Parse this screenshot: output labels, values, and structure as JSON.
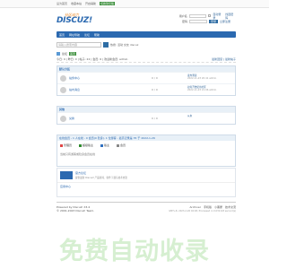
{
  "topbar": {
    "links": [
      "设为首页",
      "收藏本站",
      "开启辅助"
    ],
    "highlight": "切换到窄版"
  },
  "header": {
    "logo_sub": "社区动力",
    "logo_main": "DISCUZ!",
    "login": {
      "user_label": "用户名",
      "pass_label": "密码",
      "auto_login": "自动登录",
      "forgot": "找回密码",
      "login_button": "登录",
      "register": "立即注册"
    }
  },
  "nav": {
    "items": [
      "首页",
      "网址导航",
      "论坛",
      "帮助"
    ]
  },
  "search": {
    "placeholder": "请输入搜索内容",
    "hot": "热搜: 活动 交友 discuz"
  },
  "breadcrumb": {
    "items": [
      "论坛"
    ],
    "current": "首页"
  },
  "stats": {
    "text": "今日: 0 | 昨日: 0 | 帖子: 22 | 会员: 6 | 欢迎新会员: admin",
    "right": "最新回复 | 最新帖子"
  },
  "categories": [
    {
      "name": "默认分区",
      "forums": [
        {
          "name": "站务中心",
          "count": "0 / 0",
          "last_title": "发布测试",
          "last_meta": "2022-11-23 20:41 admin"
        },
        {
          "name": "站内消息",
          "count": "0 / 0",
          "last_title": "如何开始使用社区",
          "last_meta": "2022-11-23 21:06 admin"
        }
      ]
    },
    {
      "name": "其他",
      "forums": [
        {
          "name": "兑换",
          "count": "0 / 0",
          "last_title": "从未",
          "last_meta": ""
        }
      ]
    }
  ],
  "online": {
    "head": "在线会员 - 1 人在线 - 0 会员(0 隐身), 1 位游客 - 最高记录是 35 于 2022-1-26",
    "legend": [
      "管理员",
      "超级版主",
      "版主",
      "会员"
    ],
    "legend_colors": [
      "#e04646",
      "#2e8b2e",
      "#3070c0",
      "#888888"
    ],
    "note": "当前只有游客或隐身会员在线"
  },
  "friends": {
    "title": "官方论坛",
    "desc": "提供最新 Discuz! 产品新闻、软件下载与技术交流",
    "link2": "应用中心"
  },
  "footer": {
    "powered": "Powered by Discuz! X3.4",
    "copyright": "© 2001-2023 Discuz! Team.",
    "links": [
      "Archiver",
      "手机版",
      "小黑屋",
      "技术交流"
    ],
    "gmt": "GMT+8, 2023-2-26 04:48, Processed in 0.031118 second(s)"
  },
  "watermark": "免费自动收录"
}
